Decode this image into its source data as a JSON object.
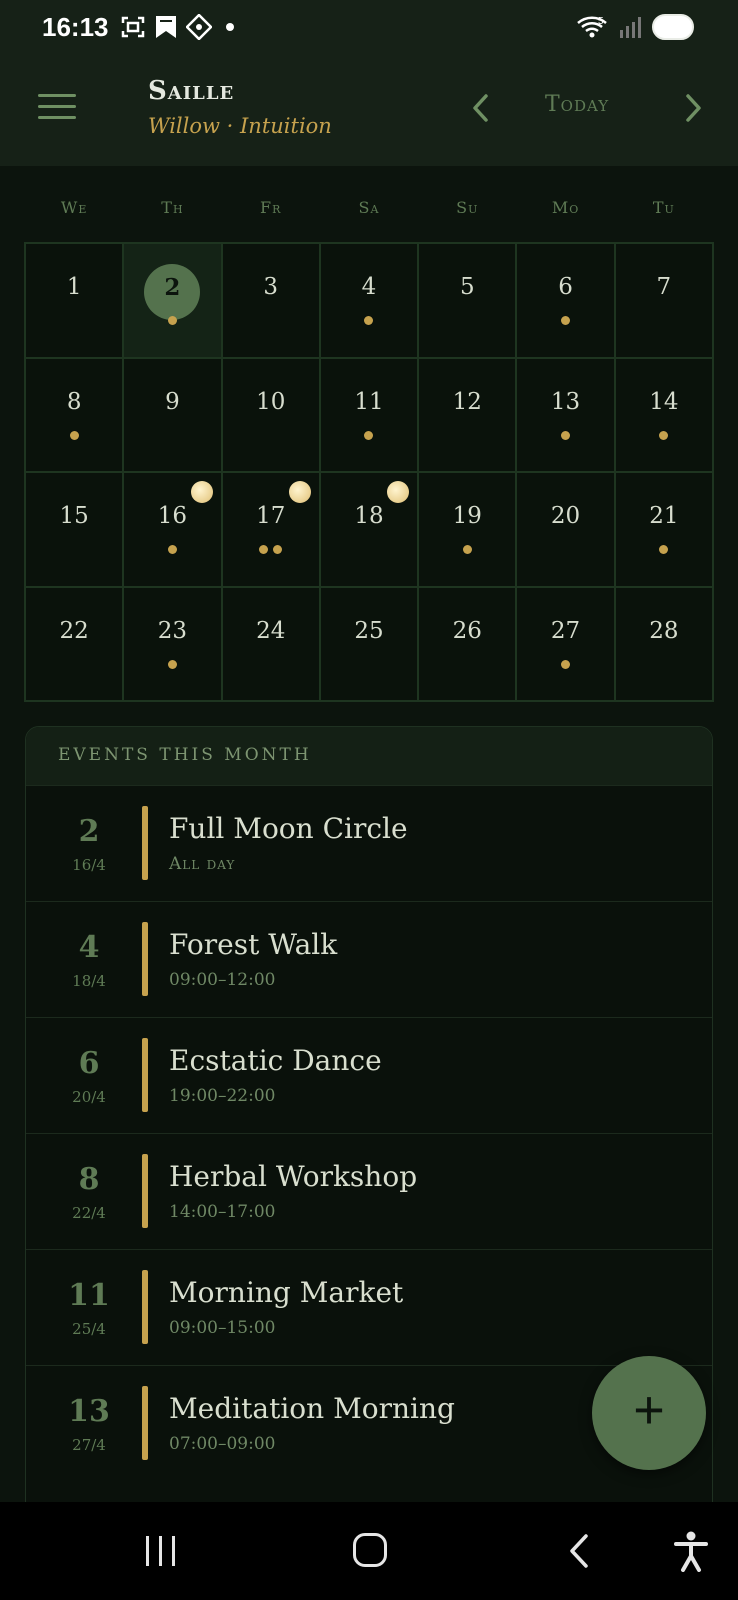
{
  "status": {
    "time": "16:13",
    "icons_left": [
      "screenshot-icon",
      "bookmark-icon",
      "app-icon",
      "dot-icon"
    ],
    "icons_right": [
      "wifi-icon",
      "signal-icon",
      "battery-icon"
    ],
    "wifi_label": "5"
  },
  "header": {
    "title": "Saille",
    "subtitle": "Willow · Intuition",
    "today_label": "Today",
    "icons": [
      "menu-icon",
      "chevron-left-icon",
      "chevron-right-icon"
    ]
  },
  "weekdays": [
    "We",
    "Th",
    "Fr",
    "Sa",
    "Su",
    "Mo",
    "Tu"
  ],
  "calendar": {
    "selected_day": 2,
    "days": [
      {
        "n": "1",
        "dots": 0,
        "moon": false
      },
      {
        "n": "2",
        "dots": 1,
        "moon": false,
        "today": true
      },
      {
        "n": "3",
        "dots": 0,
        "moon": false
      },
      {
        "n": "4",
        "dots": 1,
        "moon": false
      },
      {
        "n": "5",
        "dots": 0,
        "moon": false
      },
      {
        "n": "6",
        "dots": 1,
        "moon": false
      },
      {
        "n": "7",
        "dots": 0,
        "moon": false
      },
      {
        "n": "8",
        "dots": 1,
        "moon": false
      },
      {
        "n": "9",
        "dots": 0,
        "moon": false
      },
      {
        "n": "10",
        "dots": 0,
        "moon": false
      },
      {
        "n": "11",
        "dots": 1,
        "moon": false
      },
      {
        "n": "12",
        "dots": 0,
        "moon": false
      },
      {
        "n": "13",
        "dots": 1,
        "moon": false
      },
      {
        "n": "14",
        "dots": 1,
        "moon": false
      },
      {
        "n": "15",
        "dots": 0,
        "moon": false
      },
      {
        "n": "16",
        "dots": 1,
        "moon": true
      },
      {
        "n": "17",
        "dots": 2,
        "moon": true
      },
      {
        "n": "18",
        "dots": 0,
        "moon": true
      },
      {
        "n": "19",
        "dots": 1,
        "moon": false
      },
      {
        "n": "20",
        "dots": 0,
        "moon": false
      },
      {
        "n": "21",
        "dots": 1,
        "moon": false
      },
      {
        "n": "22",
        "dots": 0,
        "moon": false
      },
      {
        "n": "23",
        "dots": 1,
        "moon": false
      },
      {
        "n": "24",
        "dots": 0,
        "moon": false
      },
      {
        "n": "25",
        "dots": 0,
        "moon": false
      },
      {
        "n": "26",
        "dots": 0,
        "moon": false
      },
      {
        "n": "27",
        "dots": 1,
        "moon": false
      },
      {
        "n": "28",
        "dots": 0,
        "moon": false
      }
    ]
  },
  "events": {
    "heading": "EVENTS THIS MONTH",
    "items": [
      {
        "day": "2",
        "date": "16/4",
        "title": "Full Moon Circle",
        "time": "All day"
      },
      {
        "day": "4",
        "date": "18/4",
        "title": "Forest Walk",
        "time": "09:00–12:00"
      },
      {
        "day": "6",
        "date": "20/4",
        "title": "Ecstatic Dance",
        "time": "19:00–22:00"
      },
      {
        "day": "8",
        "date": "22/4",
        "title": "Herbal Workshop",
        "time": "14:00–17:00"
      },
      {
        "day": "11",
        "date": "25/4",
        "title": "Morning Market",
        "time": "09:00–15:00"
      },
      {
        "day": "13",
        "date": "27/4",
        "title": "Meditation Morning",
        "time": "07:00–09:00"
      }
    ]
  },
  "fab": {
    "label": "+",
    "icon": "plus-icon"
  },
  "navbar": {
    "icons": [
      "recents-icon",
      "home-icon",
      "back-icon",
      "accessibility-icon"
    ]
  },
  "colors": {
    "background": "#0c140d",
    "header": "#162117",
    "accent_gold": "#c6a24e",
    "accent_green": "#54724d",
    "muted_green": "#5f7b55"
  }
}
